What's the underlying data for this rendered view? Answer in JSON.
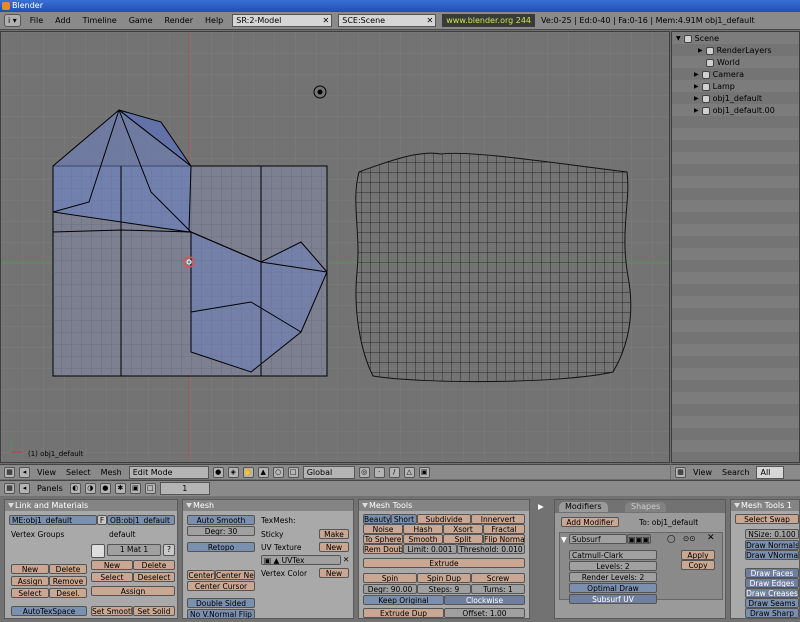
{
  "window": {
    "title": "Blender"
  },
  "info": {
    "menus": [
      "File",
      "Add",
      "Timeline",
      "Game",
      "Render",
      "Help"
    ],
    "screen": "SR:2-Model",
    "scene": "SCE:Scene",
    "url": "www.blender.org 244",
    "stats": "Ve:0-25 | Ed:0-40 | Fa:0-16 | Mem:4.91M obj1_default"
  },
  "viewport": {
    "object_label": "(1) obj1_default"
  },
  "outliner": {
    "items": [
      "Scene",
      "RenderLayers",
      "World",
      "Camera",
      "Lamp",
      "obj1_default",
      "obj1_default.00"
    ]
  },
  "view3d_header": {
    "menus": [
      "View",
      "Select",
      "Mesh"
    ],
    "mode": "Edit Mode",
    "orientation": "Global"
  },
  "outliner_header": {
    "menus": [
      "View",
      "Search"
    ],
    "filter": "All Sce"
  },
  "buttons_header": {
    "panels": "Panels",
    "frame": "1"
  },
  "link_materials": {
    "title": "Link and Materials",
    "me": "ME:obj1_default",
    "f": "F",
    "ob": "OB:obj1_default",
    "vgroups": "Vertex Groups",
    "default": "default",
    "mat": "1 Mat 1",
    "q": "?",
    "new": "New",
    "delete": "Delete",
    "assign": "Assign",
    "remove": "Remove",
    "select": "Select",
    "desel": "Desel.",
    "new2": "New",
    "delete2": "Delete",
    "select2": "Select",
    "deselect2": "Deselect",
    "assign2": "Assign",
    "autotex": "AutoTexSpace",
    "setsmooth": "Set Smooth",
    "setsolid": "Set Solid"
  },
  "mesh": {
    "title": "Mesh",
    "autosmooth": "Auto Smooth",
    "degr": "Degr: 30",
    "retopo": "Retopo",
    "texmesh": "TexMesh:",
    "sticky": "Sticky",
    "make": "Make",
    "uvtex": "UV Texture",
    "new": "New",
    "uvtexname": "UVTex",
    "vcol": "Vertex Color",
    "new2": "New",
    "center": "Center",
    "centernew": "Center New",
    "centercursor": "Center Cursor",
    "doublesided": "Double Sided",
    "novnormal": "No V.Normal Flip"
  },
  "mesh_tools": {
    "title": "Mesh Tools",
    "beauty": "Beauty",
    "short": "Short",
    "subdivide": "Subdivide",
    "innervert": "Innervert",
    "noise": "Noise",
    "hash": "Hash",
    "xsort": "Xsort",
    "fractal": "Fractal",
    "tosphere": "To Sphere",
    "smooth": "Smooth",
    "split": "Split",
    "flipnormal": "Flip Normal",
    "remdoubl": "Rem Doubl",
    "limit": "Limit: 0.001",
    "threshold": "Threshold: 0.010",
    "extrude": "Extrude",
    "spin": "Spin",
    "spindup": "Spin Dup",
    "screw": "Screw",
    "degr": "Degr: 90.00",
    "steps": "Steps: 9",
    "turns": "Turns: 1",
    "keeporiginal": "Keep Original",
    "clockwise": "Clockwise",
    "extrudedup": "Extrude Dup",
    "offset": "Offset: 1.00"
  },
  "modifiers": {
    "tab1": "Modifiers",
    "tab2": "Shapes",
    "add": "Add Modifier",
    "to": "To: obj1_default",
    "subsurf": "Subsurf",
    "catmull": "Catmull-Clark",
    "levels": "Levels: 2",
    "rlevels": "Render Levels: 2",
    "optimal": "Optimal Draw",
    "subsurfuv": "Subsurf UV",
    "apply": "Apply",
    "copy": "Copy"
  },
  "mesh_tools1": {
    "title": "Mesh Tools 1",
    "selectswap": "Select Swap",
    "nsize": "NSize: 0.100",
    "drawnormals": "Draw Normals",
    "drawvnormals": "Draw VNormals",
    "drawfaces": "Draw Faces",
    "drawedges": "Draw Edges",
    "drawcreases": "Draw Creases",
    "drawseams": "Draw Seams",
    "drawsharp": "Draw Sharp"
  }
}
